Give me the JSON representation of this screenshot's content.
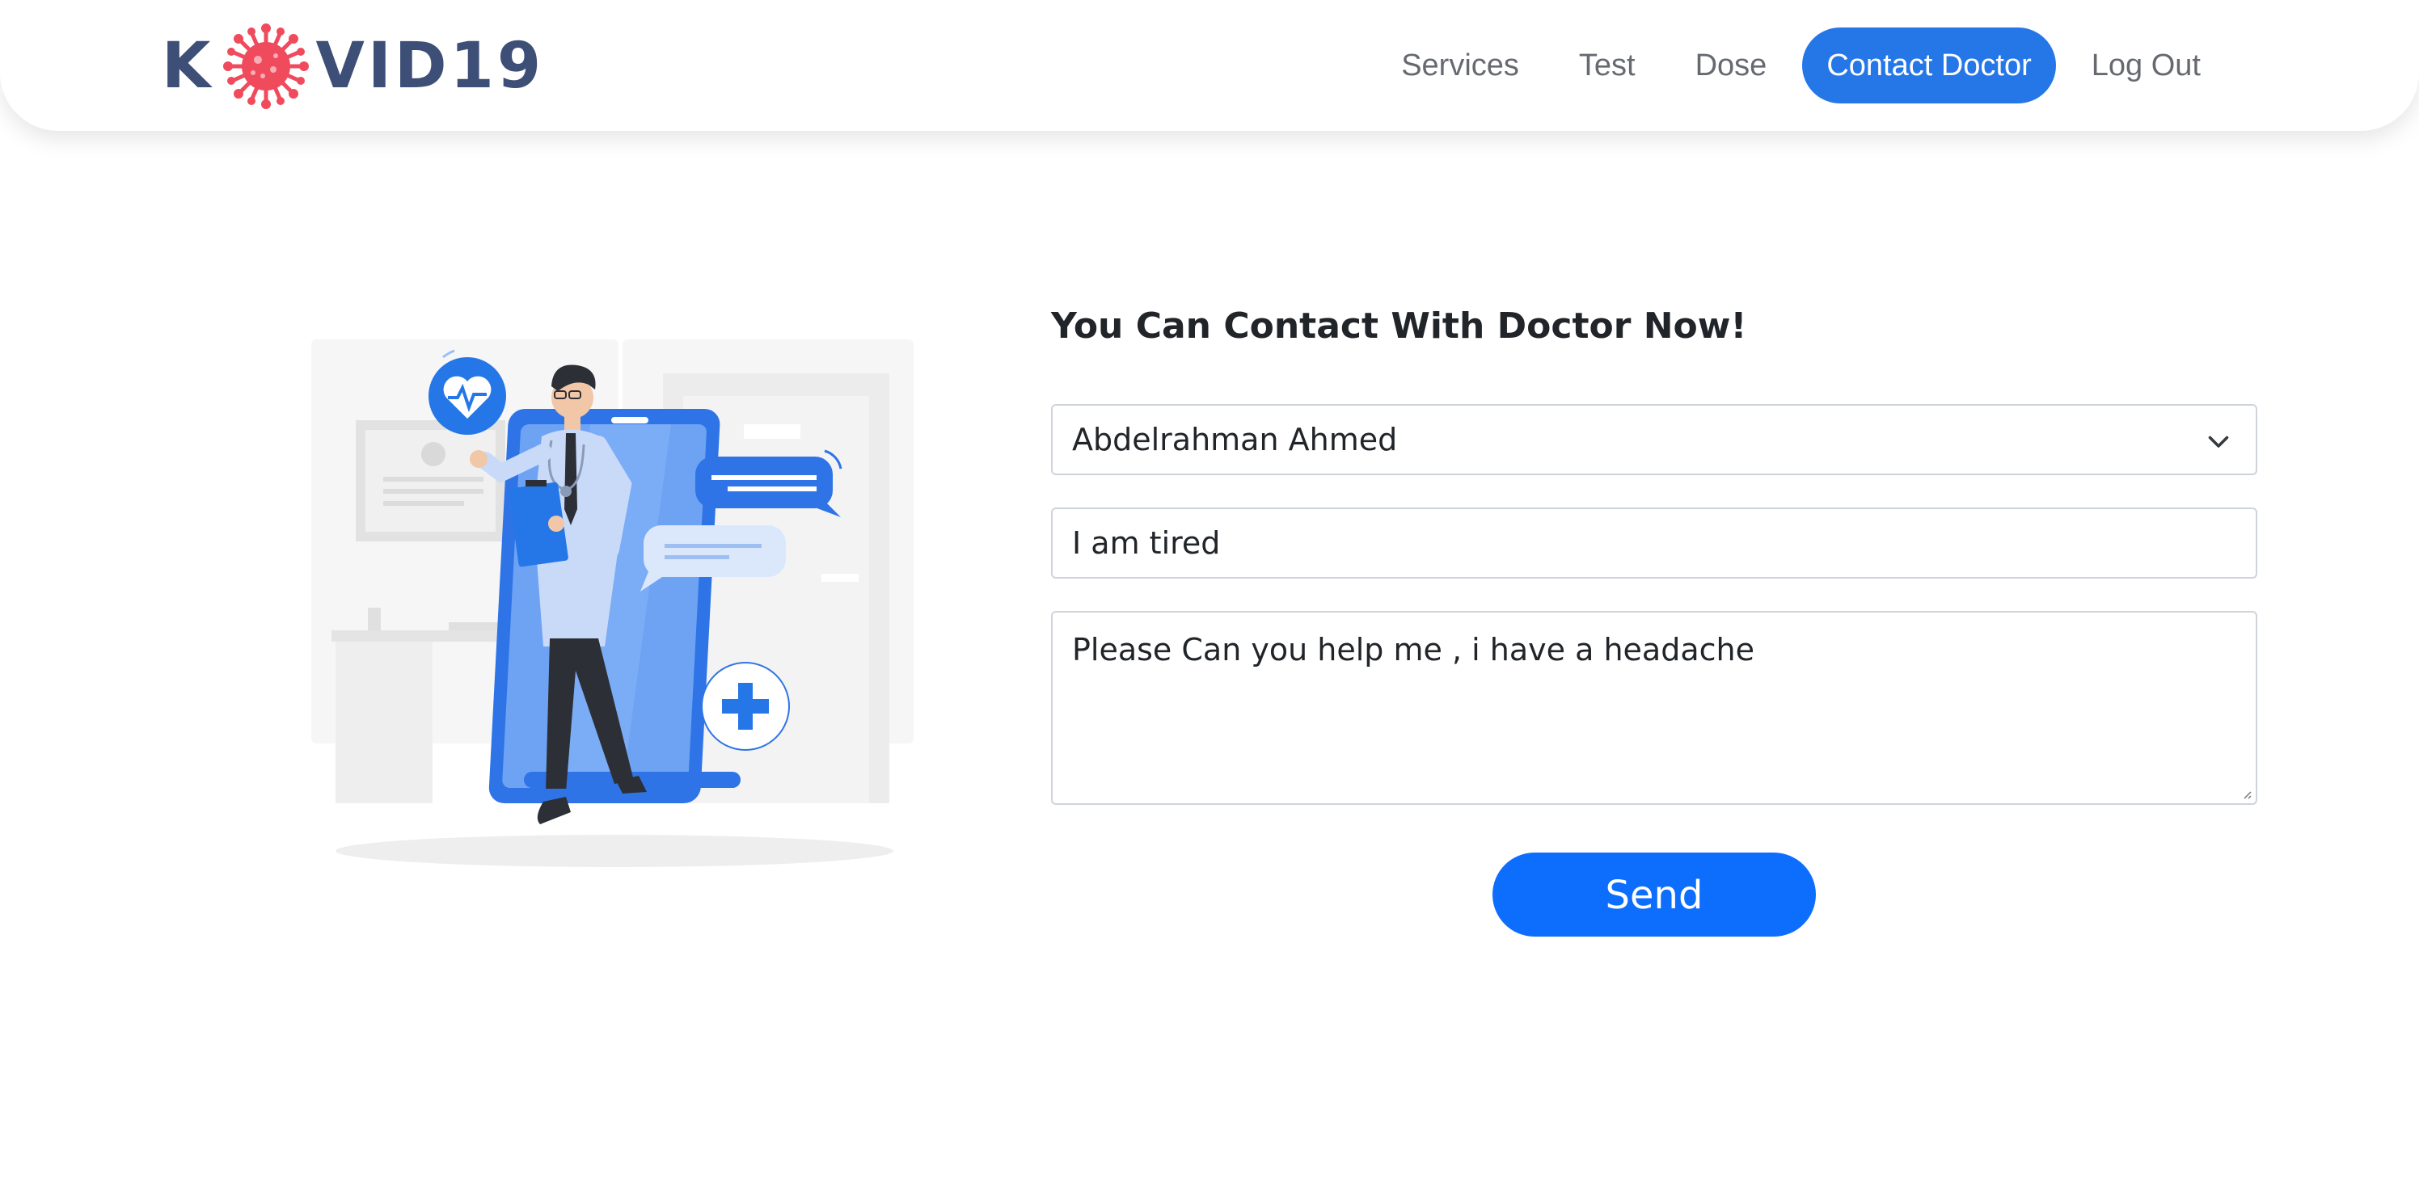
{
  "brand": {
    "prefix": "K",
    "suffix": "VID19",
    "icon": "virus-icon",
    "accent_color": "#f04a5d"
  },
  "nav": {
    "items": [
      {
        "label": "Services",
        "active": false
      },
      {
        "label": "Test",
        "active": false
      },
      {
        "label": "Dose",
        "active": false
      },
      {
        "label": "Contact Doctor",
        "active": true
      },
      {
        "label": "Log Out",
        "active": false
      }
    ],
    "active_color": "#2577e8"
  },
  "illustration": {
    "icon": "doctor-phone-illustration",
    "primary_color": "#2e74e6"
  },
  "form": {
    "title": "You Can Contact With Doctor Now!",
    "doctor_select": {
      "value": "Abdelrahman Ahmed",
      "icon": "chevron-down-icon"
    },
    "subject_input": {
      "value": "I am tired"
    },
    "message_textarea": {
      "value": "Please Can you help me , i have a headache"
    },
    "send_label": "Send",
    "button_color": "#0d6efd"
  }
}
